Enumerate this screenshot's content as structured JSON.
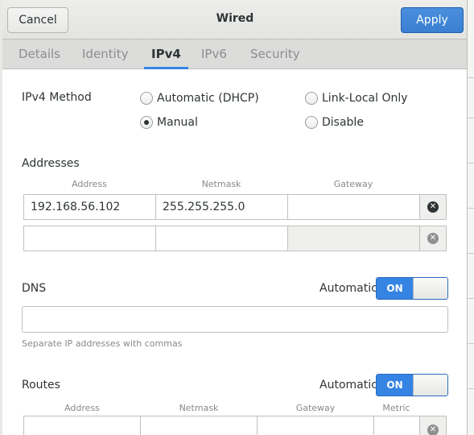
{
  "dialog": {
    "title": "Wired",
    "cancel_label": "Cancel",
    "apply_label": "Apply"
  },
  "tabs": [
    {
      "label": "Details"
    },
    {
      "label": "Identity"
    },
    {
      "label": "IPv4",
      "active": true
    },
    {
      "label": "IPv6"
    },
    {
      "label": "Security"
    }
  ],
  "ipv4_method": {
    "label": "IPv4 Method",
    "options": [
      {
        "label": "Automatic (DHCP)",
        "checked": false
      },
      {
        "label": "Link-Local Only",
        "checked": false
      },
      {
        "label": "Manual",
        "checked": true
      },
      {
        "label": "Disable",
        "checked": false
      }
    ]
  },
  "addresses": {
    "heading": "Addresses",
    "columns": [
      "Address",
      "Netmask",
      "Gateway"
    ],
    "rows": [
      {
        "address": "192.168.56.102",
        "netmask": "255.255.255.0",
        "gateway": ""
      },
      {
        "address": "",
        "netmask": "",
        "gateway": ""
      }
    ]
  },
  "dns": {
    "heading": "DNS",
    "automatic_label": "Automatic",
    "switch_label": "ON",
    "automatic_on": true,
    "value": "",
    "hint": "Separate IP addresses with commas"
  },
  "routes": {
    "heading": "Routes",
    "automatic_label": "Automatic",
    "switch_label": "ON",
    "automatic_on": true,
    "columns": [
      "Address",
      "Netmask",
      "Gateway",
      "Metric"
    ]
  },
  "colors": {
    "accent": "#3584e4",
    "text": "#2e3436",
    "muted": "#888a85"
  },
  "icons": {
    "delete_row": "edit-clear-icon"
  }
}
